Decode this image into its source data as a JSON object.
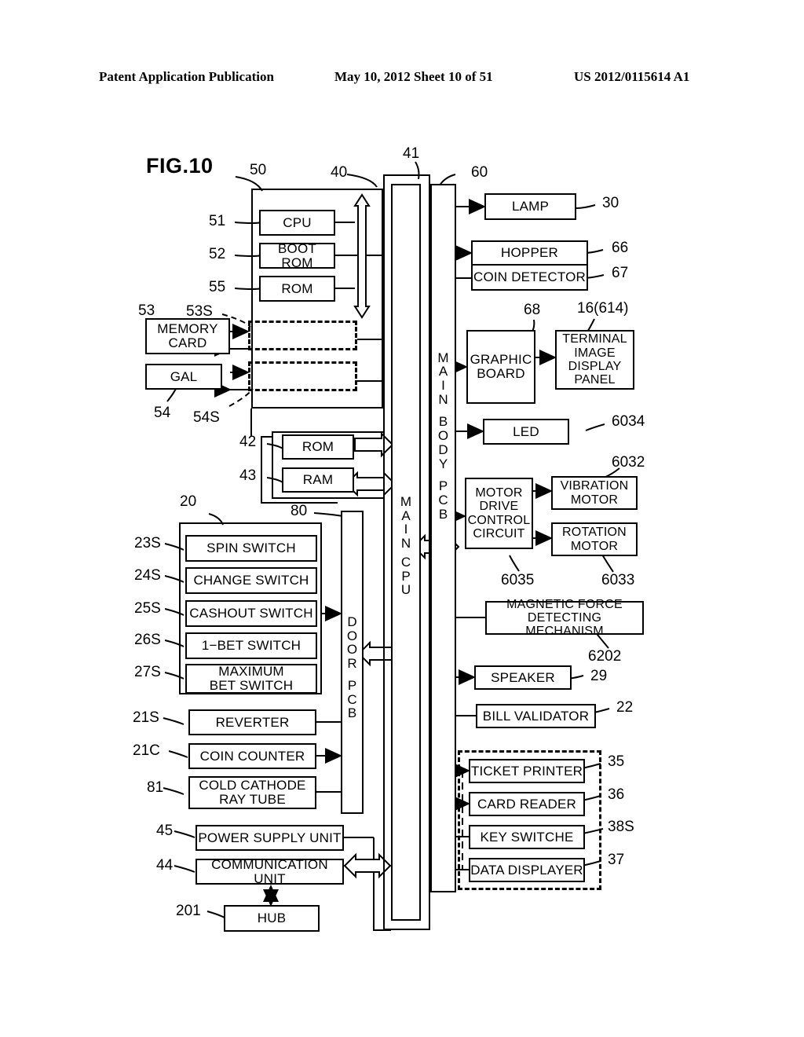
{
  "header": {
    "publication": "Patent Application Publication",
    "date_sheet": "May 10, 2012  Sheet 10 of 51",
    "patent_number": "US 2012/0115614 A1"
  },
  "figure": {
    "label": "FIG.10"
  },
  "blocks": {
    "cpu": "CPU",
    "boot_rom": "BOOT ROM",
    "rom_55": "ROM",
    "memory_card": "MEMORY\nCARD",
    "gal": "GAL",
    "rom_42": "ROM",
    "ram_43": "RAM",
    "spin_switch": "SPIN SWITCH",
    "change_switch": "CHANGE SWITCH",
    "cashout_switch": "CASHOUT SWITCH",
    "one_bet_switch": "1−BET SWITCH",
    "maximum_bet_switch": "MAXIMUM\nBET SWITCH",
    "reverter": "REVERTER",
    "coin_counter": "COIN COUNTER",
    "cold_cathode_ray_tube": "COLD CATHODE\nRAY TUBE",
    "power_supply_unit": "POWER SUPPLY UNIT",
    "communication_unit": "COMMUNICATION UNIT",
    "hub": "HUB",
    "lamp": "LAMP",
    "hopper": "HOPPER",
    "coin_detector": "COIN DETECTOR",
    "graphic_board": "GRAPHIC\nBOARD",
    "terminal_image_display_panel": "TERMINAL\nIMAGE\nDISPLAY\nPANEL",
    "led": "LED",
    "motor_drive_control_circuit": "MOTOR\nDRIVE\nCONTROL\nCIRCUIT",
    "vibration_motor": "VIBRATION\nMOTOR",
    "rotation_motor": "ROTATION\nMOTOR",
    "magnetic_force_detecting_mechanism": "MAGNETIC FORCE\nDETECTING MECHANISM",
    "speaker": "SPEAKER",
    "bill_validator": "BILL VALIDATOR",
    "ticket_printer": "TICKET PRINTER",
    "card_reader": "CARD READER",
    "key_switche": "KEY SWITCHE",
    "data_displayer": "DATA DISPLAYER"
  },
  "vertical_bars": {
    "main_cpu": "MAIN CPU",
    "main_body_pcb": "MAIN BODY PCB",
    "door_pcb": "DOOR PCB"
  },
  "refs": {
    "r20": "20",
    "r21C": "21C",
    "r21S": "21S",
    "r22": "22",
    "r23S": "23S",
    "r24S": "24S",
    "r25S": "25S",
    "r26S": "26S",
    "r27S": "27S",
    "r29": "29",
    "r30": "30",
    "r35": "35",
    "r36": "36",
    "r37": "37",
    "r38S": "38S",
    "r40": "40",
    "r41": "41",
    "r42": "42",
    "r43": "43",
    "r44": "44",
    "r45": "45",
    "r50": "50",
    "r51": "51",
    "r52": "52",
    "r53": "53",
    "r53S": "53S",
    "r54": "54",
    "r54S": "54S",
    "r55": "55",
    "r60": "60",
    "r66": "66",
    "r67": "67",
    "r68": "68",
    "r80": "80",
    "r81": "81",
    "r201": "201",
    "r6032": "6032",
    "r6033": "6033",
    "r6034": "6034",
    "r6035": "6035",
    "r6202": "6202",
    "r16_614": "16(614)"
  },
  "colors": {
    "ink": "#000000",
    "paper": "#ffffff"
  }
}
